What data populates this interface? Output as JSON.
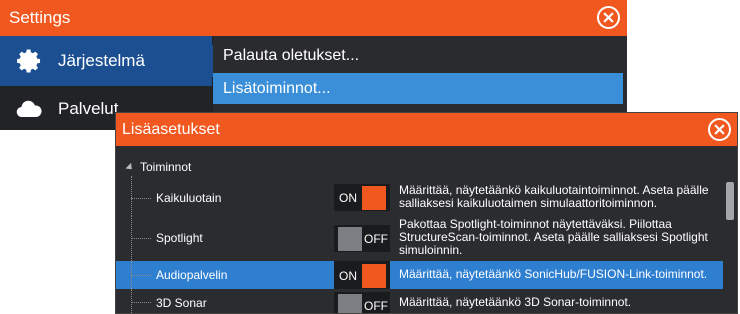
{
  "settings": {
    "title": "Settings",
    "sidebar": [
      {
        "label": "Järjestelmä",
        "icon": "gear-icon"
      },
      {
        "label": "Palvelut",
        "icon": "cloud-icon"
      }
    ],
    "submenu": [
      "Palauta oletukset...",
      "Lisätoiminnot..."
    ]
  },
  "dialog": {
    "title": "Lisäasetukset",
    "group": "Toiminnot",
    "rows": [
      {
        "name": "Kaikuluotain",
        "state": "ON",
        "desc": "Määrittää, näytetäänkö kaikuluotaintoiminnot. Aseta päälle salliaksesi kaikuluotaimen simulaattoritoiminnon."
      },
      {
        "name": "Spotlight",
        "state": "OFF",
        "desc": "Pakottaa Spotlight-toiminnot näytettäväksi. Piilottaa StructureScan-toiminnot. Aseta päälle salliaksesi Spotlight simuloinnin."
      },
      {
        "name": "Audiopalvelin",
        "state": "ON",
        "desc": "Määrittää, näytetäänkö SonicHub/FUSION-Link-toiminnot."
      },
      {
        "name": "3D Sonar",
        "state": "OFF",
        "desc": "Määrittää, näytetäänkö 3D Sonar-toiminnot."
      }
    ]
  },
  "colors": {
    "accent": "#f0581f",
    "selection": "#2f7fd1",
    "nav_active": "#1c4f92"
  }
}
